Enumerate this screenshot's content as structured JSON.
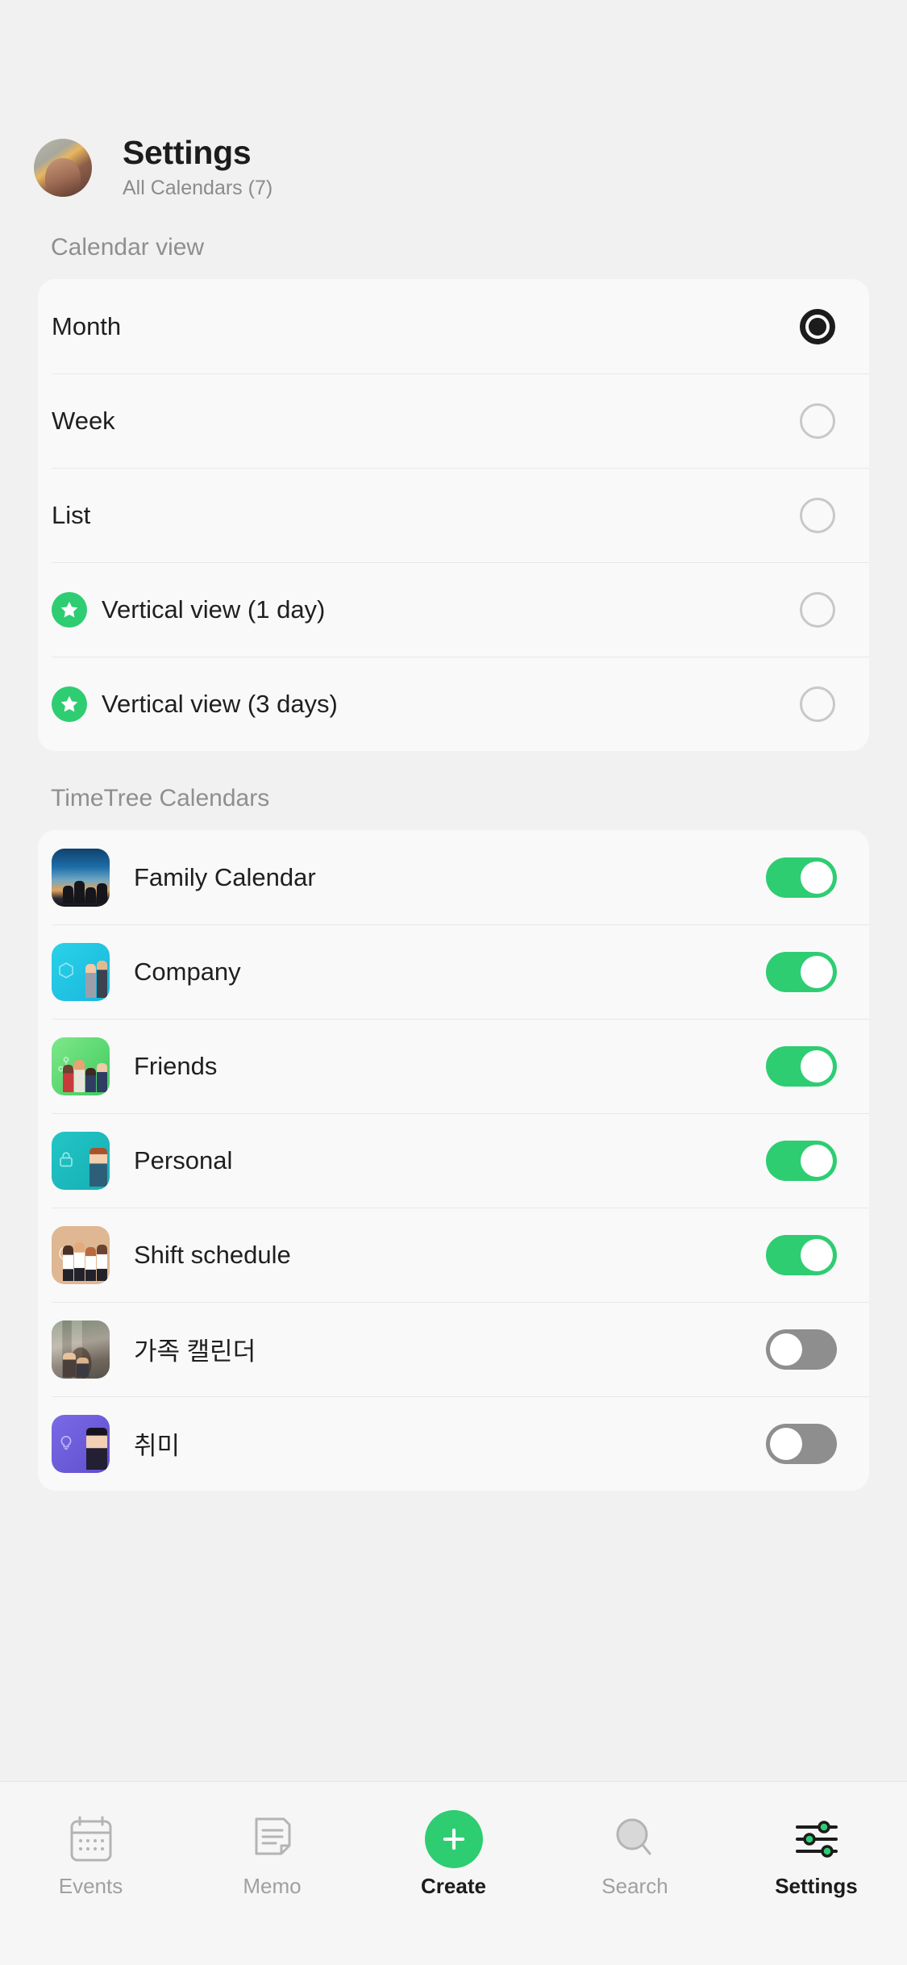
{
  "header": {
    "avatar_name": "user-avatar",
    "title": "Settings",
    "subtitle": "All Calendars (7)"
  },
  "calendar_view": {
    "section_label": "Calendar view",
    "options": [
      {
        "label": "Month",
        "selected": true,
        "premium": false
      },
      {
        "label": "Week",
        "selected": false,
        "premium": false
      },
      {
        "label": "List",
        "selected": false,
        "premium": false
      },
      {
        "label": "Vertical view (1 day)",
        "selected": false,
        "premium": true
      },
      {
        "label": "Vertical view (3 days)",
        "selected": false,
        "premium": true
      }
    ]
  },
  "timetree_calendars": {
    "section_label": "TimeTree Calendars",
    "items": [
      {
        "label": "Family Calendar",
        "enabled": true,
        "thumb": "family-calendar-thumb"
      },
      {
        "label": "Company",
        "enabled": true,
        "thumb": "company-thumb"
      },
      {
        "label": "Friends",
        "enabled": true,
        "thumb": "friends-thumb"
      },
      {
        "label": "Personal",
        "enabled": true,
        "thumb": "personal-thumb"
      },
      {
        "label": "Shift schedule",
        "enabled": true,
        "thumb": "shift-schedule-thumb"
      },
      {
        "label": "가족 캘린더",
        "enabled": false,
        "thumb": "korean-family-thumb"
      },
      {
        "label": "취미",
        "enabled": false,
        "thumb": "hobby-thumb"
      }
    ]
  },
  "tabbar": {
    "tabs": [
      {
        "label": "Events",
        "icon": "calendar-icon",
        "active": false
      },
      {
        "label": "Memo",
        "icon": "memo-icon",
        "active": false
      },
      {
        "label": "Create",
        "icon": "plus-icon",
        "active": false
      },
      {
        "label": "Search",
        "icon": "search-icon",
        "active": false
      },
      {
        "label": "Settings",
        "icon": "sliders-icon",
        "active": true
      }
    ]
  },
  "colors": {
    "accent_green": "#2ecd72",
    "toggle_off_gray": "#8e8e8e",
    "page_background": "#f1f1f1",
    "card_background": "#f9f9f9",
    "text_primary": "#1f1f1f",
    "text_muted": "#8f8f8f"
  }
}
